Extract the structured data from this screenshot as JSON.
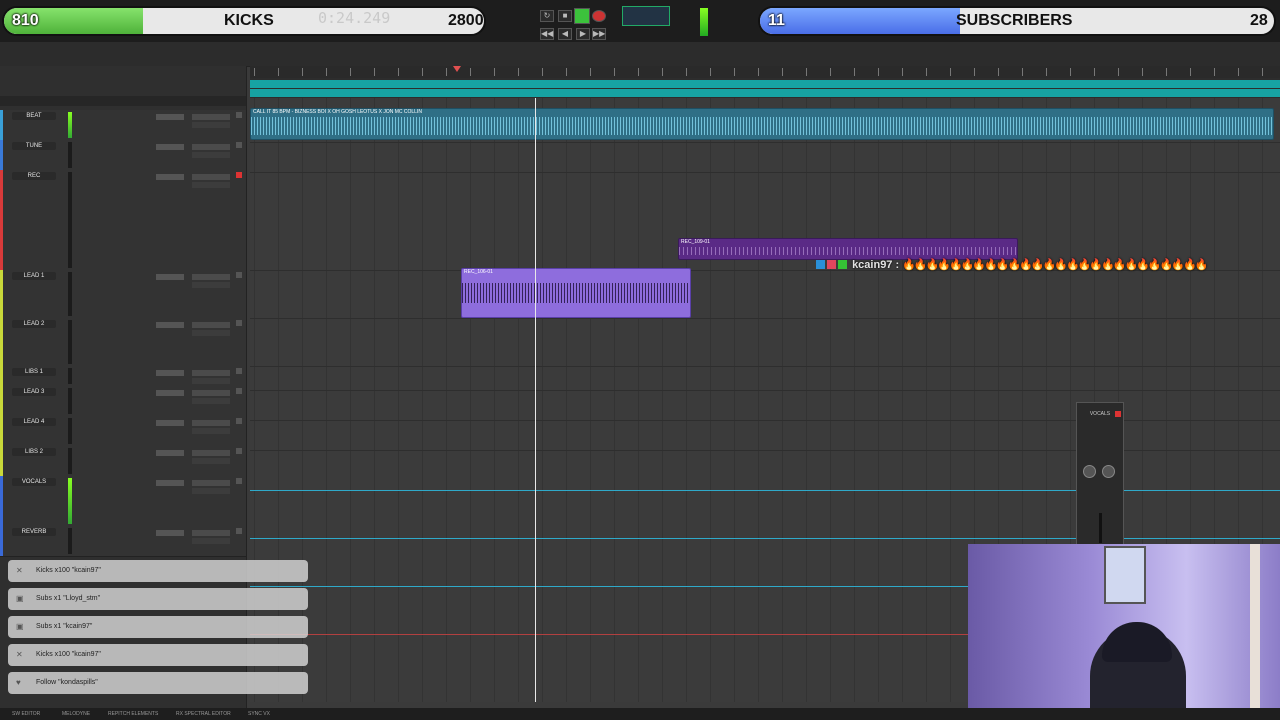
{
  "goals": {
    "kicks": {
      "current": "810",
      "title": "KICKS",
      "target": "2800",
      "progress": 0.29
    },
    "subs": {
      "current": "11",
      "title": "SUBSCRIBERS",
      "target": "28",
      "progress": 0.39
    }
  },
  "transport": {
    "counter": "0:24.249"
  },
  "tracks": [
    {
      "name": "BEAT",
      "color": "#3aa0d8"
    },
    {
      "name": "TUNE",
      "color": "#3a7ad8"
    },
    {
      "name": "REC",
      "color": "#d83a3a"
    },
    {
      "name": "LEAD 1",
      "color": "#c8d83a"
    },
    {
      "name": "LEAD 2",
      "color": "#c8d83a"
    },
    {
      "name": "LIBS 1",
      "color": "#c8d83a"
    },
    {
      "name": "LEAD 3",
      "color": "#c8d83a"
    },
    {
      "name": "LEAD 4",
      "color": "#c8d83a"
    },
    {
      "name": "LIBS 2",
      "color": "#c8d83a"
    },
    {
      "name": "VOCALS",
      "color": "#3a6ad8"
    },
    {
      "name": "REVERB",
      "color": "#3a6ad8"
    }
  ],
  "clips": {
    "beat": "CALL IT 85 BPM - BIZNESS BOI X OH GOSH LEOTUS X JON MC COLLIN",
    "rec": "REC_109-01",
    "lead": "REC_106-01"
  },
  "chat": {
    "username": "kcain97",
    "separator": ":",
    "message": "🔥🔥🔥🔥🔥🔥🔥🔥🔥🔥🔥🔥🔥🔥🔥🔥🔥🔥🔥🔥🔥🔥🔥🔥🔥🔥"
  },
  "mini_mixer": {
    "label": "VOCALS"
  },
  "alerts": [
    {
      "icon": "x-icon",
      "text": "Kicks x100 \"kcain97\""
    },
    {
      "icon": "gift-icon",
      "text": "Subs x1 \"Lloyd_stm\""
    },
    {
      "icon": "gift-icon",
      "text": "Subs x1 \"kcain97\""
    },
    {
      "icon": "x-icon",
      "text": "Kicks x100 \"kcain97\""
    },
    {
      "icon": "heart-icon",
      "text": "Follow \"kondaspills\""
    }
  ],
  "bottom_bar": [
    "SW EDITOR",
    "MELODYNE",
    "REPITCH ELEMENTS",
    "RX SPECTRAL EDITOR",
    "SYNC VX"
  ]
}
